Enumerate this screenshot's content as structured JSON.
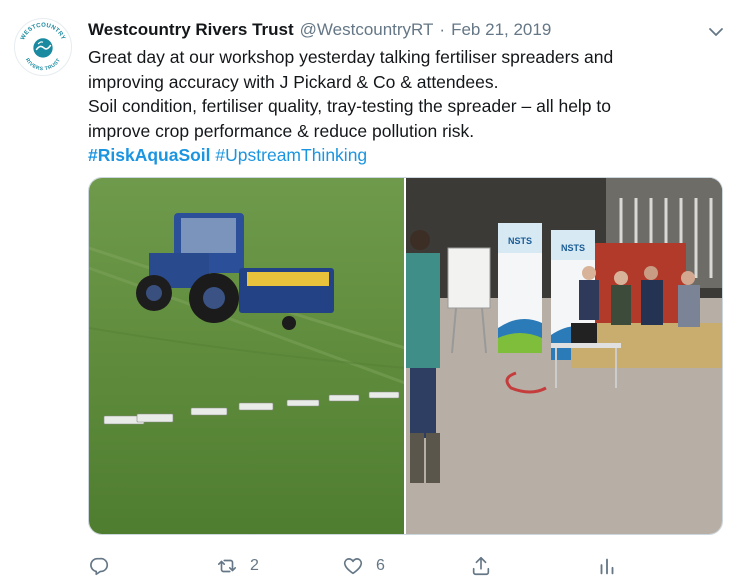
{
  "author": {
    "name": "Westcountry Rivers Trust",
    "handle": "@WestcountryRT",
    "separator": "·",
    "date": "Feb 21, 2019",
    "avatar_text_top": "WESTCOUNTRY",
    "avatar_text_bottom": "RIVERS TRUST"
  },
  "tweet": {
    "lines": [
      "Great day at our workshop yesterday talking fertiliser spreaders and",
      "improving accuracy with J Pickard & Co & attendees.",
      "Soil condition, fertiliser quality, tray-testing the spreader – all help to",
      "improve crop performance & reduce pollution risk."
    ],
    "hashtags": [
      "#RiskAquaSoil",
      "#UpstreamThinking"
    ]
  },
  "media": {
    "banner_logo_1": "NSTS",
    "banner_logo_2": "NSTS"
  },
  "actions": {
    "reply_count": "",
    "retweet_count": "2",
    "like_count": "6"
  },
  "colors": {
    "link": "#1b95e0",
    "secondary_text": "#657786",
    "brand_teal": "#1a8aa0"
  }
}
